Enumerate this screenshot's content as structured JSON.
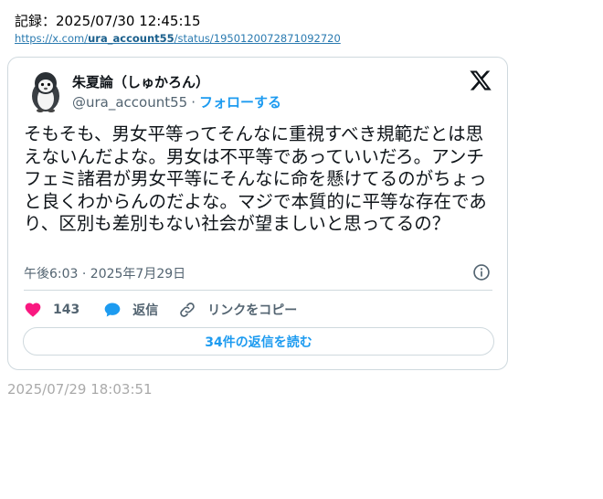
{
  "record": {
    "label": "記録：2025/07/30 12:45:15"
  },
  "url": {
    "prefix": "https://x.com/",
    "account": "ura_account55",
    "suffix": "/status/1950120072871092720"
  },
  "tweet": {
    "display_name": "朱夏論（しゅかろん）",
    "handle": "@ura_account55",
    "separator": "·",
    "follow_label": "フォローする",
    "text": "そもそも、男女平等ってそんなに重視すべき規範だとは思えないんだよな。男女は不平等であっていいだろ。アンチフェミ諸君が男女平等にそんなに命を懸けてるのがちょっと良くわからんのだよな。マジで本質的に平等な存在であり、区別も差別もない社会が望ましいと思ってるの？",
    "timestamp": "午後6:03 · 2025年7月29日",
    "likes": "143",
    "reply_label": "返信",
    "copy_link_label": "リンクをコピー",
    "read_replies_label": "34件の返信を読む"
  },
  "footer": {
    "date": "2025/07/29 18:03:51"
  },
  "colors": {
    "accent": "#1d9bf0",
    "heart": "#f91880",
    "muted": "#536471",
    "border": "#cfd9de"
  },
  "icons": [
    "penguin-avatar",
    "x-logo-icon",
    "info-icon",
    "heart-icon",
    "reply-bubble-icon",
    "link-icon"
  ]
}
